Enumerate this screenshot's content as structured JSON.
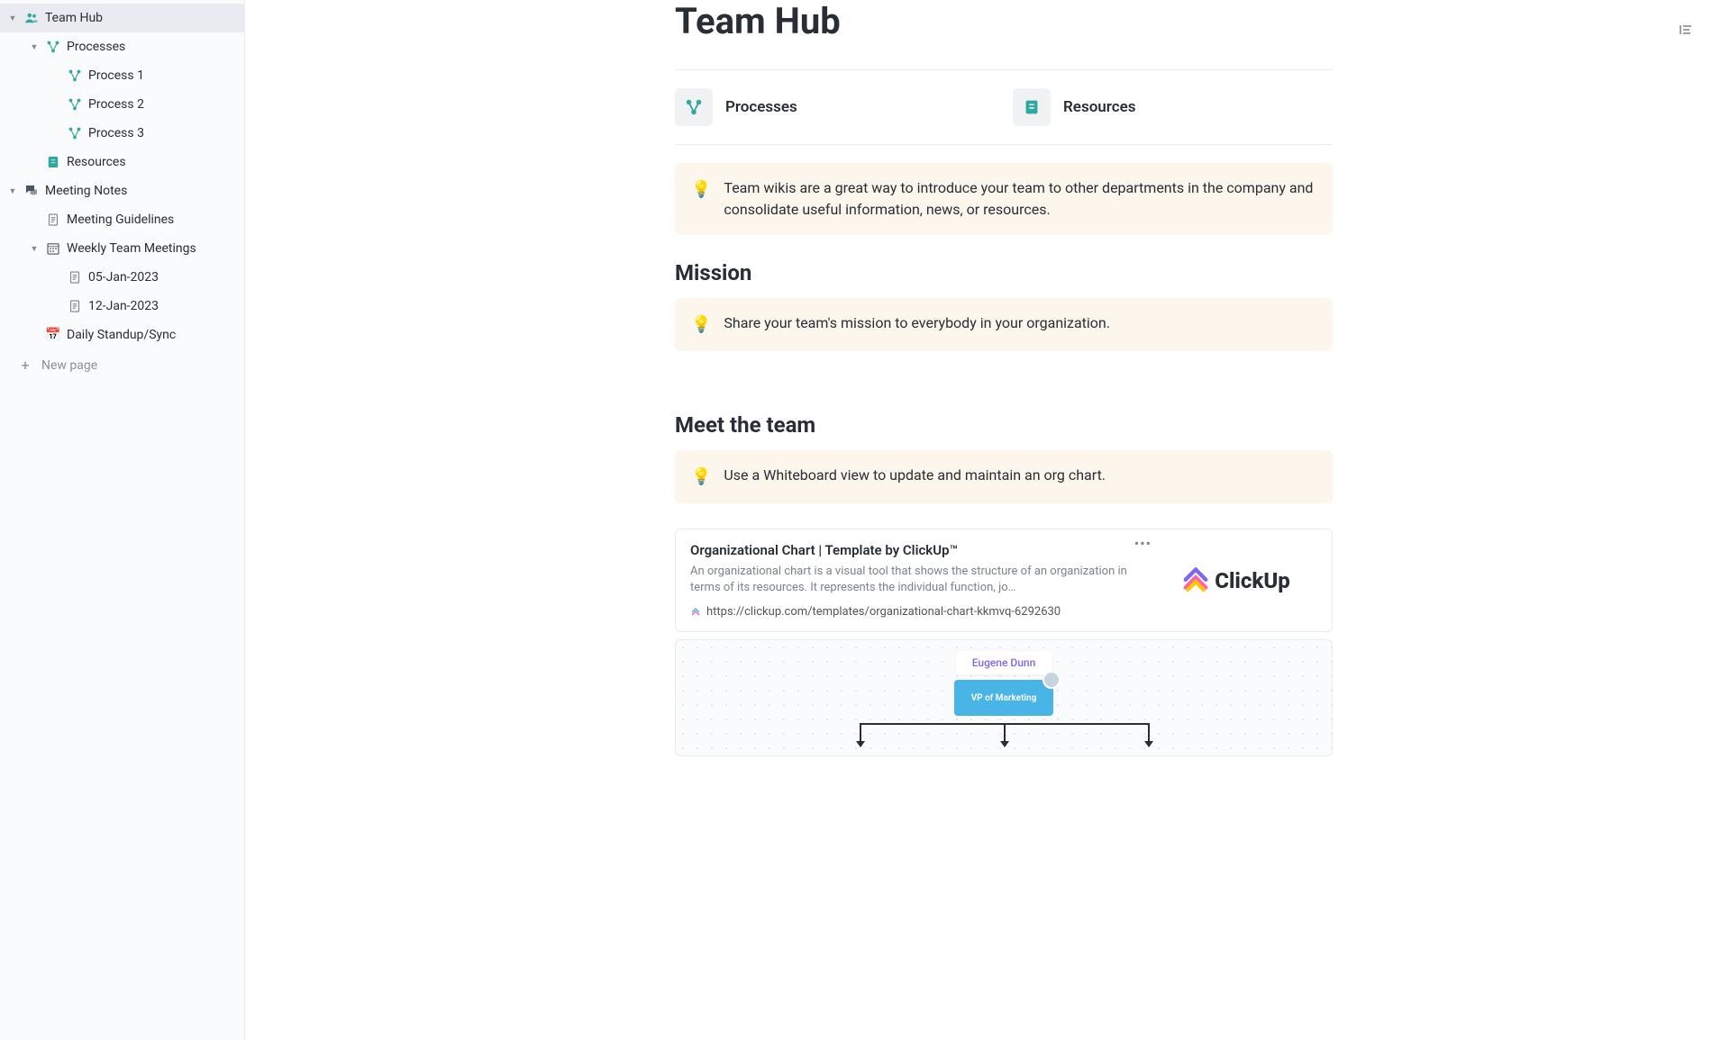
{
  "page": {
    "title": "Team Hub"
  },
  "sidebar": {
    "new_page_label": "New page",
    "items": [
      {
        "label": "Team Hub",
        "indent": 0,
        "icon": "people",
        "caret": true,
        "active": true
      },
      {
        "label": "Processes",
        "indent": 1,
        "icon": "flow",
        "caret": true
      },
      {
        "label": "Process 1",
        "indent": 2,
        "icon": "flow"
      },
      {
        "label": "Process 2",
        "indent": 2,
        "icon": "flow"
      },
      {
        "label": "Process 3",
        "indent": 2,
        "icon": "flow"
      },
      {
        "label": "Resources",
        "indent": 1,
        "icon": "book"
      },
      {
        "label": "Meeting Notes",
        "indent": 0,
        "icon": "chat",
        "caret": true
      },
      {
        "label": "Meeting Guidelines",
        "indent": 1,
        "icon": "doc"
      },
      {
        "label": "Weekly Team Meetings",
        "indent": 1,
        "icon": "calendar-grid",
        "caret": true
      },
      {
        "label": "05-Jan-2023",
        "indent": 2,
        "icon": "doc"
      },
      {
        "label": "12-Jan-2023",
        "indent": 2,
        "icon": "doc"
      },
      {
        "label": "Daily Standup/Sync",
        "indent": 1,
        "icon": "calendar-day"
      }
    ]
  },
  "cards": {
    "processes": "Processes",
    "resources": "Resources"
  },
  "callouts": {
    "intro": "Team wikis are a great way to introduce your team to other departments in the company and consolidate useful information, news, or resources.",
    "mission": "Share your team's mission to everybody in your organization.",
    "meet": "Use a Whiteboard view to update and maintain an org chart."
  },
  "sections": {
    "mission": "Mission",
    "meet": "Meet the team"
  },
  "bookmark": {
    "title": "Organizational Chart | Template by ClickUp™",
    "desc": "An organizational chart is a visual tool that shows the structure of an organization in terms of its resources. It represents the individual function, jo…",
    "url": "https://clickup.com/templates/organizational-chart-kkmvq-6292630",
    "brand": "ClickUp"
  },
  "org": {
    "name": "Eugene Dunn",
    "role": "VP of Marketing"
  }
}
